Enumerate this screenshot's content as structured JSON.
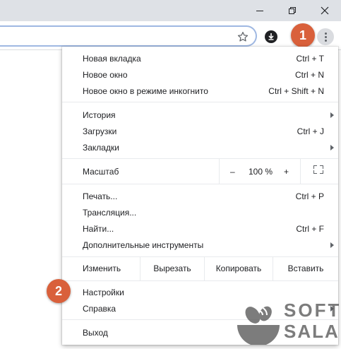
{
  "window_controls": {
    "minimize": "minimize-icon",
    "restore": "restore-icon",
    "close": "close-icon"
  },
  "toolbar": {
    "bookmark": "star-icon",
    "extension": "download-extension-icon",
    "menu": "more-vert-icon"
  },
  "badges": {
    "first": "1",
    "second": "2"
  },
  "menu": {
    "new_tab": {
      "label": "Новая вкладка",
      "shortcut": "Ctrl + T"
    },
    "new_window": {
      "label": "Новое окно",
      "shortcut": "Ctrl + N"
    },
    "incognito": {
      "label": "Новое окно в режиме инкогнито",
      "shortcut": "Ctrl + Shift + N"
    },
    "history": {
      "label": "История"
    },
    "downloads": {
      "label": "Загрузки",
      "shortcut": "Ctrl + J"
    },
    "bookmarks": {
      "label": "Закладки"
    },
    "zoom": {
      "label": "Масштаб",
      "minus": "–",
      "value": "100 %",
      "plus": "+"
    },
    "print": {
      "label": "Печать...",
      "shortcut": "Ctrl + P"
    },
    "cast": {
      "label": "Трансляция..."
    },
    "find": {
      "label": "Найти...",
      "shortcut": "Ctrl + F"
    },
    "more_tools": {
      "label": "Дополнительные инструменты"
    },
    "edit": {
      "label": "Изменить",
      "cut": "Вырезать",
      "copy": "Копировать",
      "paste": "Вставить"
    },
    "settings": {
      "label": "Настройки"
    },
    "help": {
      "label": "Справка"
    },
    "exit": {
      "label": "Выход"
    }
  },
  "watermark": {
    "line1": "SOFT",
    "line2": "SALAD"
  }
}
